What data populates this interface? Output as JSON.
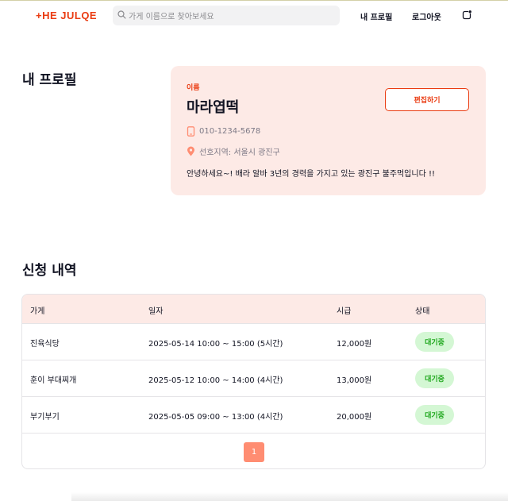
{
  "header": {
    "logo": "+HE JULQE",
    "search_placeholder": "가게 이름으로 찾아보세요",
    "nav": {
      "my_profile": "내 프로필",
      "logout": "로그아웃"
    }
  },
  "profile": {
    "title": "내 프로필",
    "name_label": "이름",
    "name": "마라엽떡",
    "edit_label": "편집하기",
    "phone": "010-1234-5678",
    "area": "선호지역: 서울시 광진구",
    "bio": "안녕하세요~! 배라 알바 3년의 경력을 가지고 있는 광진구 불주먹입니다 !!"
  },
  "applications": {
    "title": "신청 내역",
    "columns": [
      "가게",
      "일자",
      "시급",
      "상태"
    ],
    "rows": [
      {
        "store": "진육식당",
        "date": "2025-05-14 10:00 ~ 15:00 (5시간)",
        "wage": "12,000원",
        "status": "대기중"
      },
      {
        "store": "훈이 부대찌개",
        "date": "2025-05-12 10:00 ~ 14:00 (4시간)",
        "wage": "13,000원",
        "status": "대기중"
      },
      {
        "store": "부기부기",
        "date": "2025-05-05 09:00 ~ 13:00 (4시간)",
        "wage": "20,000원",
        "status": "대기중"
      }
    ],
    "pagination": {
      "current_page": "1"
    }
  },
  "colors": {
    "brand": "#ea3c12",
    "card_bg": "#fdeae6",
    "badge_bg": "#d4f7d4",
    "badge_text": "#20a81e",
    "page_active": "#ff8d72"
  },
  "icons": {
    "search": "search-icon",
    "notification": "notification-icon",
    "phone": "phone-icon",
    "location": "location-pin-icon"
  }
}
